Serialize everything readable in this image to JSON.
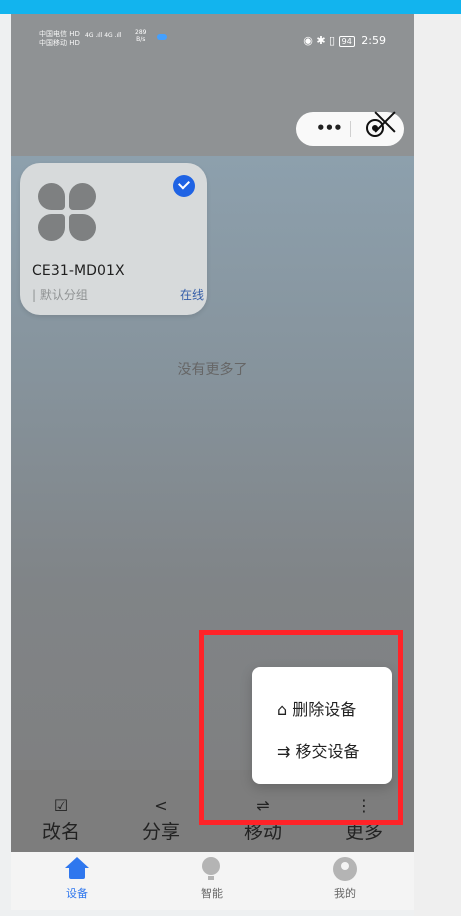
{
  "status_bar": {
    "carrier_1": "中国电信 HD",
    "carrier_2": "中国移动 HD",
    "signal": "4G .ıll  4G .ıll",
    "net_speed": "289",
    "net_speed_unit": "B/s",
    "battery": "94",
    "time": "2:59"
  },
  "header": {
    "more_glyph": "•••"
  },
  "device_card": {
    "name": "CE31-MD01X",
    "group": "| 默认分组",
    "status": "在线"
  },
  "list_end_text": "没有更多了",
  "actions": [
    {
      "label": "改名",
      "icon": "☑"
    },
    {
      "label": "分享",
      "icon": "<"
    },
    {
      "label": "移动",
      "icon": "⇌"
    },
    {
      "label": "更多",
      "icon": "⋮"
    }
  ],
  "popup": {
    "delete_label": "删除设备",
    "transfer_label": "移交设备"
  },
  "tabbar": {
    "device": "设备",
    "smart": "智能",
    "mine": "我的"
  },
  "colors": {
    "accent_blue": "#1f63e4",
    "tab_active": "#2f77ee",
    "highlight_red": "#ff2328"
  }
}
